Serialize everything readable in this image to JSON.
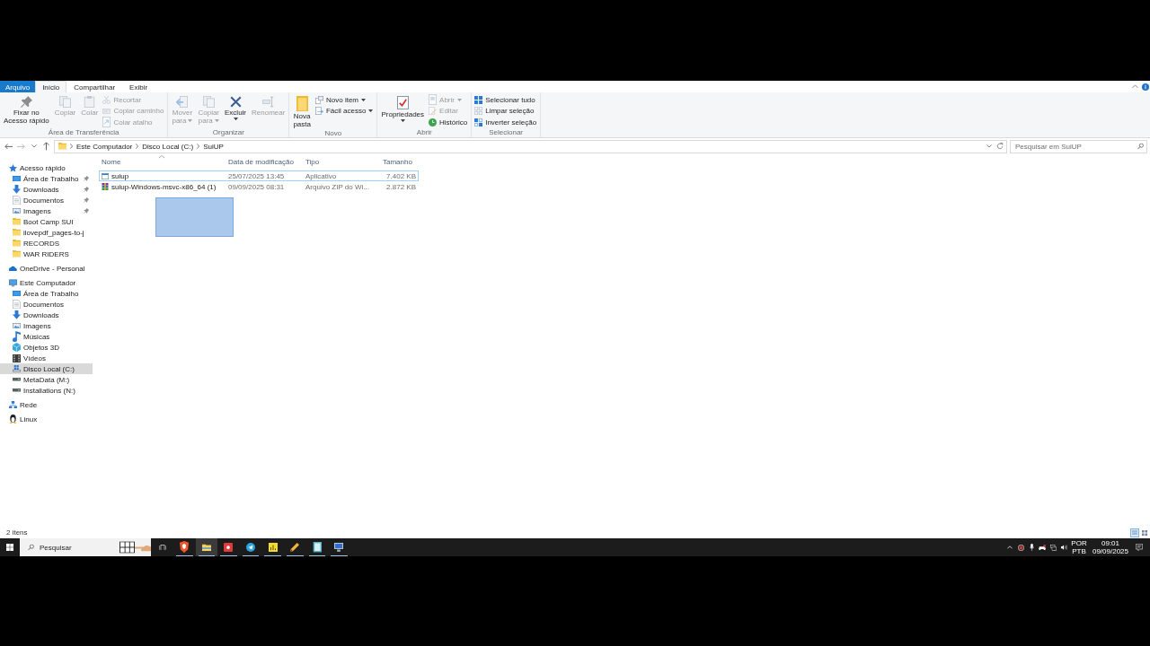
{
  "ribbon": {
    "tabs": [
      {
        "label": "Arquivo",
        "kind": "menu",
        "selected": false
      },
      {
        "label": "Início",
        "kind": "tab",
        "selected": true
      },
      {
        "label": "Compartilhar",
        "kind": "tab",
        "selected": false
      },
      {
        "label": "Exibir",
        "kind": "tab",
        "selected": false
      }
    ],
    "groups": [
      {
        "label": "Área de Transferência",
        "large": [
          {
            "kind": "pin",
            "label": "Fixar no Acesso rápido",
            "disabled": false,
            "dropdown": false
          },
          {
            "kind": "copy",
            "label": "Copiar",
            "disabled": true,
            "dropdown": false
          },
          {
            "kind": "paste",
            "label": "Colar",
            "disabled": true,
            "dropdown": false
          }
        ],
        "small": [
          {
            "kind": "cut",
            "label": "Recortar",
            "disabled": true,
            "dropdown": false
          },
          {
            "kind": "copypath",
            "label": "Copiar caminho",
            "disabled": true,
            "dropdown": false
          },
          {
            "kind": "shortcut",
            "label": "Colar atalho",
            "disabled": true,
            "dropdown": false
          }
        ]
      },
      {
        "label": "Organizar",
        "large": [
          {
            "kind": "move",
            "label": "Mover para",
            "disabled": true,
            "dropdown": true
          },
          {
            "kind": "copyto",
            "label": "Copiar para",
            "disabled": true,
            "dropdown": true
          },
          {
            "kind": "delete",
            "label": "Excluir",
            "disabled": false,
            "dropdown": true
          },
          {
            "kind": "rename",
            "label": "Renomear",
            "disabled": true,
            "dropdown": false
          }
        ]
      },
      {
        "label": "Novo",
        "large": [
          {
            "kind": "newfolder",
            "label": "Nova pasta",
            "disabled": false,
            "dropdown": false
          }
        ],
        "small": [
          {
            "kind": "newitem",
            "label": "Novo item",
            "disabled": false,
            "dropdown": true
          },
          {
            "kind": "easyaccess",
            "label": "Fácil acesso",
            "disabled": false,
            "dropdown": true
          }
        ]
      },
      {
        "label": "Abrir",
        "large": [
          {
            "kind": "properties",
            "label": "Propriedades",
            "disabled": false,
            "dropdown": true
          }
        ],
        "small": [
          {
            "kind": "open",
            "label": "Abrir",
            "disabled": true,
            "dropdown": true
          },
          {
            "kind": "edit",
            "label": "Editar",
            "disabled": true,
            "dropdown": false
          },
          {
            "kind": "history",
            "label": "Histórico",
            "disabled": false,
            "dropdown": false
          }
        ]
      },
      {
        "label": "Selecionar",
        "small": [
          {
            "kind": "selectall",
            "label": "Selecionar tudo",
            "disabled": false,
            "dropdown": false
          },
          {
            "kind": "selectnone",
            "label": "Limpar seleção",
            "disabled": false,
            "dropdown": false
          },
          {
            "kind": "invert",
            "label": "Inverter seleção",
            "disabled": false,
            "dropdown": false
          }
        ]
      }
    ]
  },
  "navigation": [
    {
      "kind": "back",
      "disabled": false
    },
    {
      "kind": "forward",
      "disabled": true
    },
    {
      "kind": "recent",
      "disabled": false
    },
    {
      "kind": "up",
      "disabled": false
    }
  ],
  "address_bar": {
    "path": [
      "Este Computador",
      "Disco Local (C:)",
      "SuiUP"
    ]
  },
  "search": {
    "placeholder": "Pesquisar em SuiUP"
  },
  "sidebar": {
    "items": [
      {
        "label": "Acesso rápido",
        "kind": "star",
        "selected": false,
        "pinned": false,
        "children": [
          {
            "label": "Área de Trabalho",
            "kind": "desktop",
            "selected": false,
            "pinned": true
          },
          {
            "label": "Downloads",
            "kind": "download",
            "selected": false,
            "pinned": true
          },
          {
            "label": "Documentos",
            "kind": "document",
            "selected": false,
            "pinned": true
          },
          {
            "label": "Imagens",
            "kind": "pictures",
            "selected": false,
            "pinned": true
          },
          {
            "label": "Boot Camp SUI",
            "kind": "folder",
            "selected": false,
            "pinned": false
          },
          {
            "label": "ilovepdf_pages-to-j",
            "kind": "folder",
            "selected": false,
            "pinned": false
          },
          {
            "label": "RECORDS",
            "kind": "folder",
            "selected": false,
            "pinned": false
          },
          {
            "label": "WAR RIDERS",
            "kind": "folder",
            "selected": false,
            "pinned": false
          }
        ]
      },
      {
        "label": "OneDrive - Personal",
        "kind": "cloud",
        "selected": false,
        "pinned": false
      },
      {
        "label": "Este Computador",
        "kind": "computer",
        "selected": false,
        "pinned": false,
        "children": [
          {
            "label": "Área de Trabalho",
            "kind": "desktop",
            "selected": false,
            "pinned": false
          },
          {
            "label": "Documentos",
            "kind": "document",
            "selected": false,
            "pinned": false
          },
          {
            "label": "Downloads",
            "kind": "download",
            "selected": false,
            "pinned": false
          },
          {
            "label": "Imagens",
            "kind": "pictures",
            "selected": false,
            "pinned": false
          },
          {
            "label": "Músicas",
            "kind": "music",
            "selected": false,
            "pinned": false
          },
          {
            "label": "Objetos 3D",
            "kind": "objects3d",
            "selected": false,
            "pinned": false
          },
          {
            "label": "Vídeos",
            "kind": "videos",
            "selected": false,
            "pinned": false
          },
          {
            "label": "Disco Local (C:)",
            "kind": "sysdrive",
            "selected": true,
            "pinned": false
          },
          {
            "label": "MetaData (M:)",
            "kind": "drive",
            "selected": false,
            "pinned": false
          },
          {
            "label": "Installations (N:)",
            "kind": "drive",
            "selected": false,
            "pinned": false
          }
        ]
      },
      {
        "label": "Rede",
        "kind": "network",
        "selected": false,
        "pinned": false
      },
      {
        "label": "Linux",
        "kind": "linux",
        "selected": false,
        "pinned": false
      }
    ]
  },
  "file_list": {
    "columns": [
      {
        "label": "Nome",
        "sorted": true
      },
      {
        "label": "Data de modificação",
        "sorted": false
      },
      {
        "label": "Tipo",
        "sorted": false
      },
      {
        "label": "Tamanho",
        "sorted": false
      }
    ],
    "rows": [
      {
        "kind": "app",
        "name": "suiup",
        "modified": "25/07/2025 13:45",
        "type": "Aplicativo",
        "size": "7.402 KB",
        "focused": true
      },
      {
        "kind": "zip",
        "name": "suiup-Windows-msvc-x86_64 (1)",
        "modified": "09/09/2025 08:31",
        "type": "Arquivo ZIP do Wi...",
        "size": "2.872 KB",
        "focused": false
      }
    ],
    "marquee": true
  },
  "status_bar": {
    "item_count": "2 itens",
    "views": [
      {
        "kind": "details",
        "selected": true
      },
      {
        "kind": "tiles",
        "selected": false
      }
    ]
  },
  "taskbar": {
    "search": {
      "placeholder": "Pesquisar"
    },
    "apps": [
      {
        "kind": "shield",
        "active": false,
        "running": true
      },
      {
        "kind": "explorer",
        "active": true,
        "running": true
      },
      {
        "kind": "record",
        "active": false,
        "running": true
      },
      {
        "kind": "plane",
        "active": false,
        "running": true
      },
      {
        "kind": "chart",
        "active": false,
        "running": true
      },
      {
        "kind": "pencil",
        "active": false,
        "running": true
      },
      {
        "kind": "notebook",
        "active": false,
        "running": true
      },
      {
        "kind": "monitor",
        "active": false,
        "running": true
      }
    ],
    "tray": {
      "language": [
        "POR",
        "PTB"
      ],
      "time": "09:01",
      "date": "09/09/2025"
    }
  }
}
